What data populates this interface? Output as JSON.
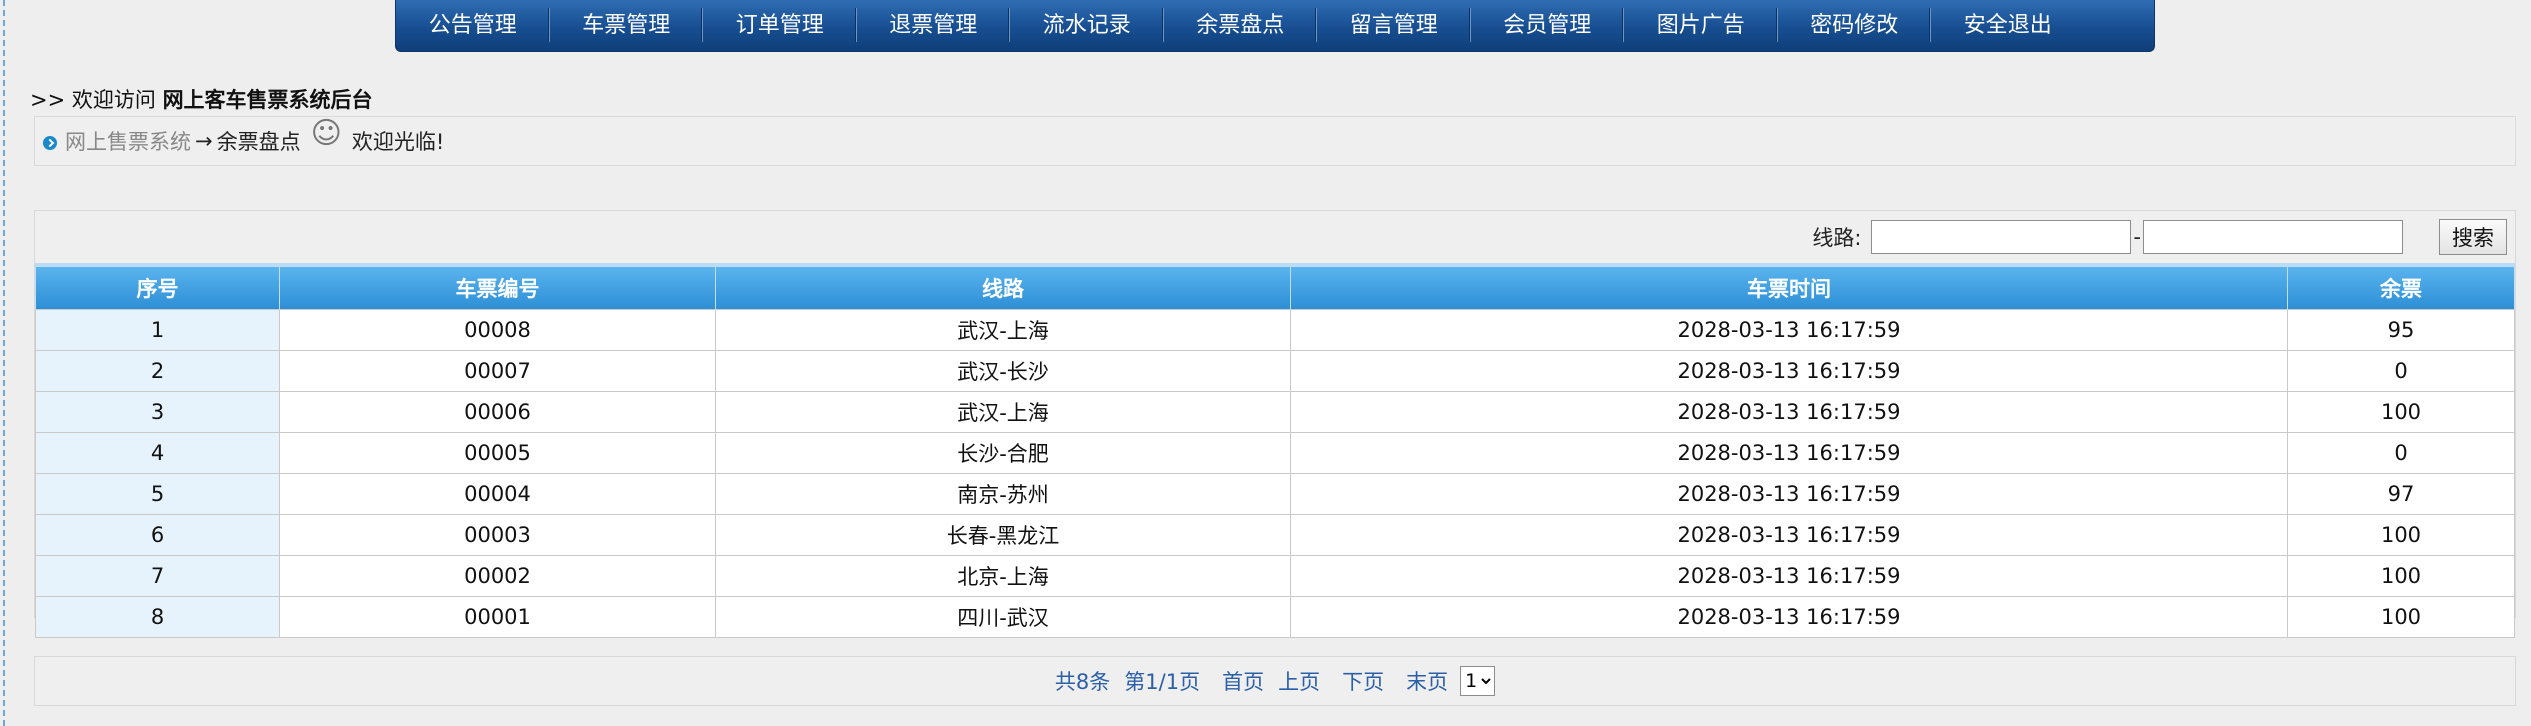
{
  "nav": {
    "items": [
      "公告管理",
      "车票管理",
      "订单管理",
      "退票管理",
      "流水记录",
      "余票盘点",
      "留言管理",
      "会员管理",
      "图片广告",
      "密码修改",
      "安全退出"
    ]
  },
  "welcome": {
    "prefix": ">> 欢迎访问",
    "site_name": "网上客车售票系统后台"
  },
  "breadcrumb": {
    "home": "网上售票系统",
    "arrow": "→",
    "current": "余票盘点",
    "face": "☺",
    "greeting": "欢迎光临!"
  },
  "search": {
    "label": "线路:",
    "from_value": "",
    "to_value": "",
    "separator": "-",
    "button": "搜索"
  },
  "table": {
    "columns": [
      "序号",
      "车票编号",
      "线路",
      "车票时间",
      "余票"
    ],
    "rows": [
      [
        "1",
        "00008",
        "武汉-上海",
        "2028-03-13 16:17:59",
        "95"
      ],
      [
        "2",
        "00007",
        "武汉-长沙",
        "2028-03-13 16:17:59",
        "0"
      ],
      [
        "3",
        "00006",
        "武汉-上海",
        "2028-03-13 16:17:59",
        "100"
      ],
      [
        "4",
        "00005",
        "长沙-合肥",
        "2028-03-13 16:17:59",
        "0"
      ],
      [
        "5",
        "00004",
        "南京-苏州",
        "2028-03-13 16:17:59",
        "97"
      ],
      [
        "6",
        "00003",
        "长春-黑龙江",
        "2028-03-13 16:17:59",
        "100"
      ],
      [
        "7",
        "00002",
        "北京-上海",
        "2028-03-13 16:17:59",
        "100"
      ],
      [
        "8",
        "00001",
        "四川-武汉",
        "2028-03-13 16:17:59",
        "100"
      ]
    ]
  },
  "pager": {
    "total": "共8条",
    "page_info": "第1/1页",
    "first": "首页",
    "prev": "上页",
    "next": "下页",
    "last": "末页",
    "select_value": "1"
  }
}
